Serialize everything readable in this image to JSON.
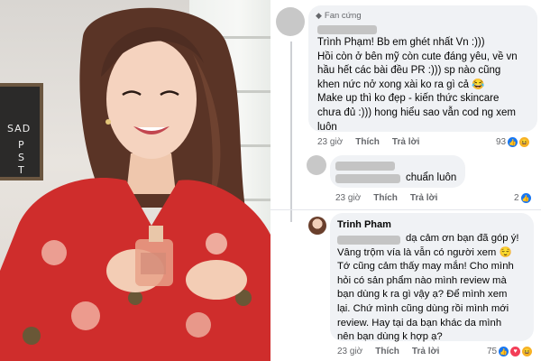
{
  "photo": {
    "board_letters": [
      "SAD",
      "P",
      "S",
      "T"
    ]
  },
  "comment1": {
    "badge": "Fan cứng",
    "lines": [
      "Trình Phạm! Bb em ghét nhất Vn :)))",
      "Hồi còn ở bên mỹ còn cute đáng yêu, về vn",
      "hầu hết các bài đều PR :))) sp nào cũng",
      "khen nức nở xong xài ko ra gì cả 😂",
      "Make up thì ko đẹp - kiến thức skincare",
      "chưa đủ :))) hong hiểu sao vẫn cod ng xem",
      "luôn"
    ],
    "time": "23 giờ",
    "like": "Thích",
    "reply": "Trả lời",
    "reactions": "93"
  },
  "comment2": {
    "text": "chuẩn luôn",
    "time": "23 giờ",
    "like": "Thích",
    "reply": "Trả lời",
    "reactions": "2"
  },
  "comment3": {
    "author": "Trinh Pham",
    "lines": [
      "dạ cảm ơn bạn đã góp ý!",
      "Vâng trộm vía là vẫn có người xem 😌",
      "Tớ cũng cảm thấy may mắn! Cho mình",
      "hỏi có sản phẩm nào mình review mà",
      "bạn dùng k ra gì vậy ạ? Để mình xem",
      "lại. Chứ mình cũng dùng rồi mình mới",
      "review. Hay tại da bạn khác da mình",
      "nên bạn dùng k hợp ạ?"
    ],
    "time": "23 giờ",
    "like": "Thích",
    "reply": "Trả lời",
    "reactions": "75"
  },
  "colors": {
    "bubble": "#f0f2f5",
    "meta": "#65676b",
    "like": "#1877f2",
    "haha": "#f7b125"
  }
}
